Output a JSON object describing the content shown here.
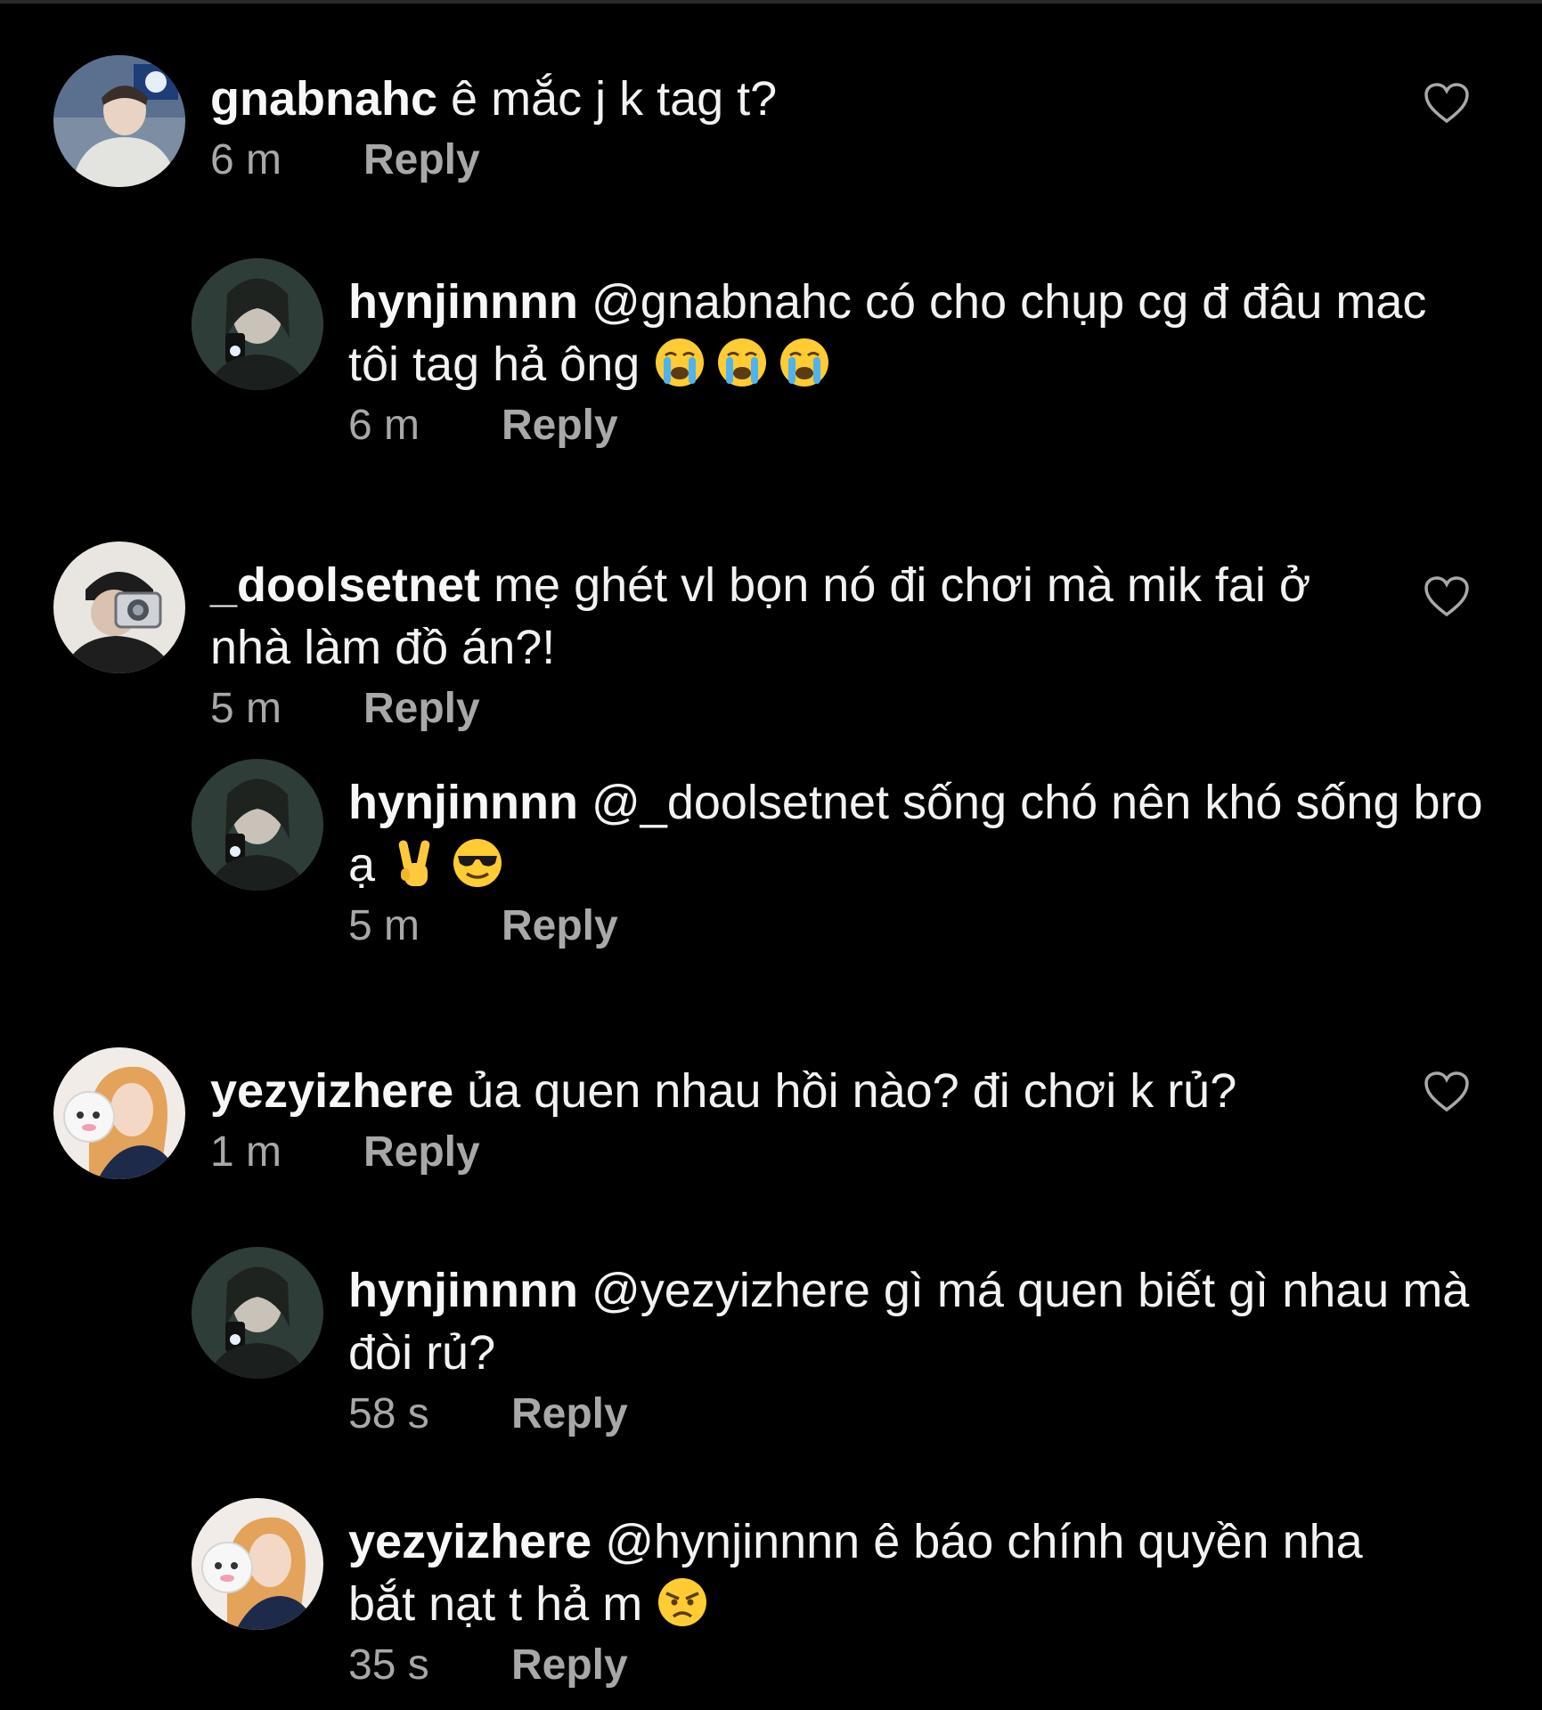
{
  "reply_label": "Reply",
  "comments": [
    {
      "username": "gnabnahc",
      "text": "ê mắc j k tag t?",
      "time": "6 m",
      "avatar_icon": "profile-photo-man-white-jacket"
    },
    {
      "username": "hynjinnnn",
      "text": "@gnabnahc có cho chụp cg đ đâu mac tôi tag hả ông",
      "emojis": [
        "loudly-crying-face-icon",
        "loudly-crying-face-icon",
        "loudly-crying-face-icon"
      ],
      "time": "6 m",
      "avatar_icon": "profile-photo-mirror-selfie"
    },
    {
      "username": "_doolsetnet",
      "text": "mẹ ghét vl bọn nó đi chơi mà mik fai ở nhà làm đồ án?!",
      "time": "5 m",
      "avatar_icon": "profile-photo-beanie-camera"
    },
    {
      "username": "hynjinnnn",
      "text": "@_doolsetnet sống chó nên khó sống bro ạ",
      "emojis": [
        "victory-hand-icon",
        "sunglasses-face-icon"
      ],
      "time": "5 m",
      "avatar_icon": "profile-photo-mirror-selfie"
    },
    {
      "username": "yezyizhere",
      "text": "ủa quen nhau hồi nào? đi chơi k rủ?",
      "time": "1 m",
      "avatar_icon": "profile-photo-girl-plush"
    },
    {
      "username": "hynjinnnn",
      "text": "@yezyizhere gì má quen biết gì nhau mà đòi rủ?",
      "time": "58 s",
      "avatar_icon": "profile-photo-mirror-selfie"
    },
    {
      "username": "yezyizhere",
      "text": "@hynjinnnn ê báo chính quyền nha bắt nạt t hả m",
      "emojis": [
        "angry-face-icon"
      ],
      "time": "35 s",
      "avatar_icon": "profile-photo-girl-plush"
    }
  ],
  "colors": {
    "background": "#000000",
    "text": "#f2f2f2",
    "secondary": "#a8a8a8"
  }
}
